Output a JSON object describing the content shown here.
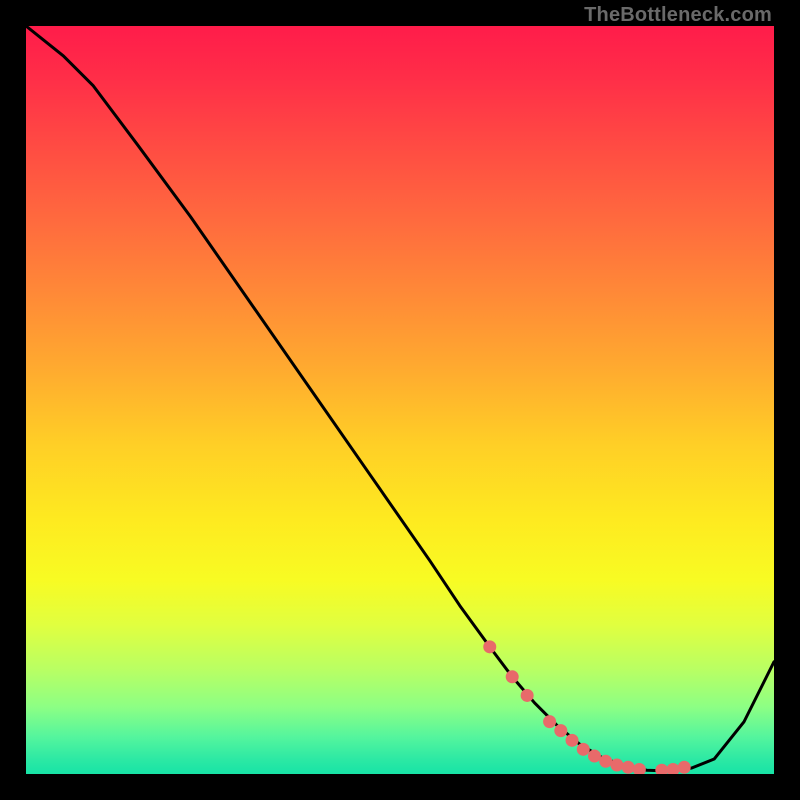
{
  "watermark": "TheBottleneck.com",
  "colors": {
    "curve_stroke": "#000000",
    "dot_fill": "#e86a6a",
    "dot_stroke": "#e86a6a",
    "background": "#000000"
  },
  "chart_data": {
    "type": "line",
    "title": "",
    "xlabel": "",
    "ylabel": "",
    "xlim": [
      0,
      100
    ],
    "ylim": [
      0,
      100
    ],
    "grid": false,
    "series": [
      {
        "name": "curve",
        "x": [
          0,
          5,
          9,
          15,
          22,
          30,
          38,
          46,
          54,
          58,
          62,
          65,
          68,
          71,
          74,
          77,
          80,
          83,
          86,
          89,
          92,
          96,
          100
        ],
        "y": [
          100,
          96,
          92,
          84,
          74.5,
          63,
          51.5,
          40,
          28.5,
          22.5,
          17,
          13,
          9.5,
          6.5,
          4,
          2.2,
          1.1,
          0.5,
          0.4,
          0.8,
          2,
          7,
          15
        ]
      }
    ],
    "scatter_points": {
      "name": "dots",
      "x": [
        62,
        65,
        67,
        70,
        71.5,
        73,
        74.5,
        76,
        77.5,
        79,
        80.5,
        82,
        85,
        86.5,
        88
      ],
      "y": [
        17,
        13,
        10.5,
        7,
        5.8,
        4.5,
        3.3,
        2.4,
        1.7,
        1.2,
        0.9,
        0.6,
        0.5,
        0.6,
        0.9
      ]
    }
  }
}
